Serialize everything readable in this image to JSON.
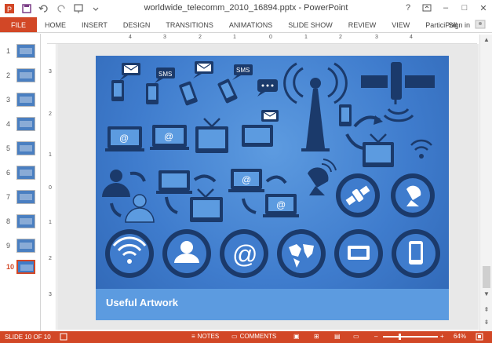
{
  "window": {
    "title": "worldwide_telecomm_2010_16894.pptx - PowerPoint",
    "help": "?",
    "controls": [
      "–",
      "□",
      "✕"
    ]
  },
  "qat": {
    "icons": [
      "powerpoint-logo-icon",
      "save-icon",
      "undo-icon",
      "redo-icon",
      "start-slideshow-icon",
      "customize-qat-icon"
    ]
  },
  "ribbon": {
    "tabs": [
      "FILE",
      "HOME",
      "INSERT",
      "DESIGN",
      "TRANSITIONS",
      "ANIMATIONS",
      "SLIDE SHOW",
      "REVIEW",
      "VIEW",
      "ParticiPoll"
    ],
    "signin": "Sign in"
  },
  "thumbnails": [
    {
      "num": "1"
    },
    {
      "num": "2"
    },
    {
      "num": "3"
    },
    {
      "num": "4"
    },
    {
      "num": "5"
    },
    {
      "num": "6"
    },
    {
      "num": "7"
    },
    {
      "num": "8"
    },
    {
      "num": "9"
    },
    {
      "num": "10",
      "active": true
    }
  ],
  "rulers": {
    "horizontal": [
      "4",
      "3",
      "2",
      "1",
      "0",
      "1",
      "2",
      "3",
      "4"
    ],
    "vertical": [
      "3",
      "2",
      "1",
      "0",
      "1",
      "2",
      "3"
    ]
  },
  "slide": {
    "footer_text": "Useful Artwork",
    "sms_label": "SMS",
    "at_label": "@",
    "colors": {
      "bg": "#3f7ccd",
      "dark": "#1b3a6b",
      "light": "#5c9be0"
    }
  },
  "statusbar": {
    "slide_info": "SLIDE 10 OF 10",
    "notes": "NOTES",
    "comments": "COMMENTS",
    "zoom_minus": "–",
    "zoom_plus": "+",
    "zoom": "64%",
    "zoom_level": 0.64
  }
}
